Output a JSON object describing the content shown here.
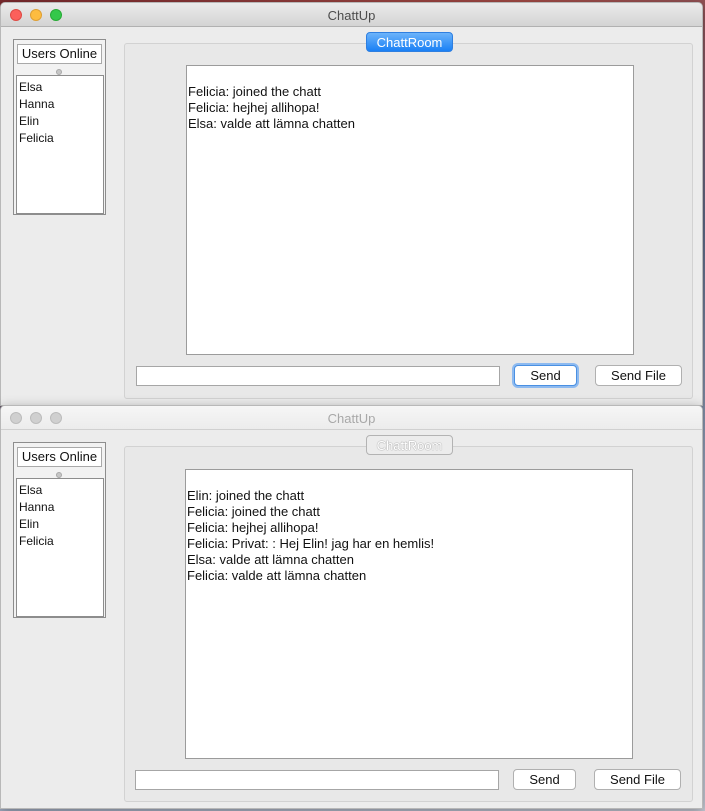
{
  "windows": [
    {
      "title": "ChattUp",
      "users_header": "Users Online",
      "users": [
        "Elsa",
        "Hanna",
        "Elin",
        "Felicia"
      ],
      "room_tab": "ChattRoom",
      "messages": [
        "Felicia: joined the chatt",
        "Felicia: hejhej allihopa!",
        "Elsa: valde att lämna chatten"
      ],
      "input_value": "",
      "send_label": "Send",
      "send_file_label": "Send File",
      "active": true
    },
    {
      "title": "ChattUp",
      "users_header": "Users Online",
      "users": [
        "Elsa",
        "Hanna",
        "Elin",
        "Felicia"
      ],
      "room_tab": "ChattRoom",
      "messages": [
        "Elin: joined the chatt",
        "Felicia: joined the chatt",
        "Felicia: hejhej allihopa!",
        "Felicia: Privat: : Hej Elin! jag har en hemlis!",
        "Elsa: valde att lämna chatten",
        "Felicia: valde att lämna chatten"
      ],
      "input_value": "",
      "send_label": "Send",
      "send_file_label": "Send File",
      "active": false
    }
  ],
  "colors": {
    "accent": "#1a80f5",
    "close": "#fc605b",
    "minimize": "#fdbc40",
    "maximize": "#34c84a"
  }
}
